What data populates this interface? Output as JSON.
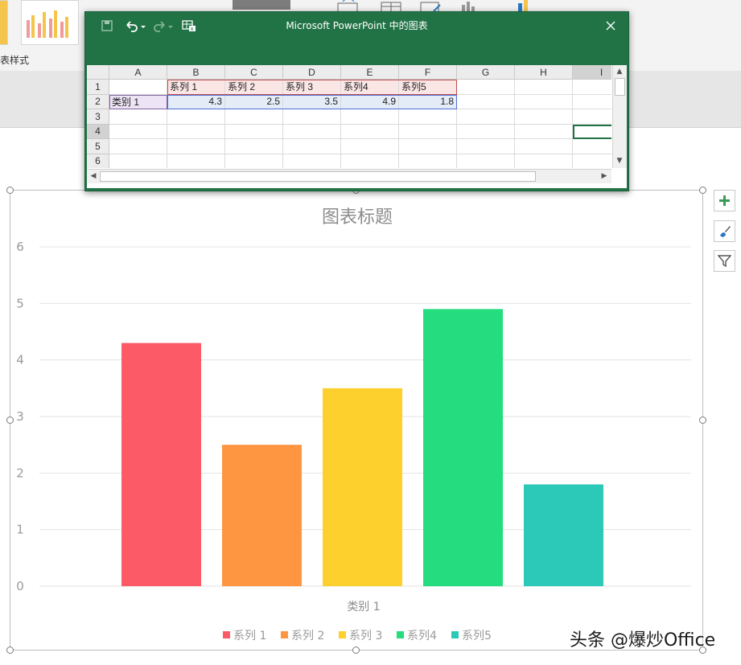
{
  "ribbon": {
    "chart_style_label": "表样式"
  },
  "window": {
    "title": "Microsoft PowerPoint 中的图表",
    "save_icon": "save-icon",
    "undo_icon": "undo-icon",
    "redo_icon": "redo-icon",
    "edit_data_icon": "edit-data-in-excel-icon",
    "close_icon": "close-icon"
  },
  "sheet": {
    "columns": [
      "A",
      "B",
      "C",
      "D",
      "E",
      "F",
      "G",
      "H",
      "I"
    ],
    "rows": [
      "1",
      "2",
      "3",
      "4",
      "5",
      "6"
    ],
    "cells": {
      "B1": "系列 1",
      "C1": "系列 2",
      "D1": "系列 3",
      "E1": "系列4",
      "F1": "系列5",
      "A2": "类别 1",
      "B2": "4.3",
      "C2": "2.5",
      "D2": "3.5",
      "E2": "4.9",
      "F2": "1.8"
    }
  },
  "side_buttons": {
    "add": "plus-icon",
    "style": "brush-icon",
    "filter": "filter-icon"
  },
  "watermark": "头条 @爆炒Office",
  "chart_data": {
    "type": "bar",
    "title": "图表标题",
    "categories": [
      "类别 1"
    ],
    "series": [
      {
        "name": "系列 1",
        "values": [
          4.3
        ],
        "color": "#fb5a66"
      },
      {
        "name": "系列 2",
        "values": [
          2.5
        ],
        "color": "#fd9541"
      },
      {
        "name": "系列 3",
        "values": [
          3.5
        ],
        "color": "#fdd02d"
      },
      {
        "name": "系列4",
        "values": [
          4.9
        ],
        "color": "#25dd7e"
      },
      {
        "name": "系列5",
        "values": [
          1.8
        ],
        "color": "#2cc9b8"
      }
    ],
    "ylim": [
      0,
      6
    ],
    "yticks": [
      "0",
      "1",
      "2",
      "3",
      "4",
      "5",
      "6"
    ],
    "grid": true,
    "legend": "bottom"
  }
}
